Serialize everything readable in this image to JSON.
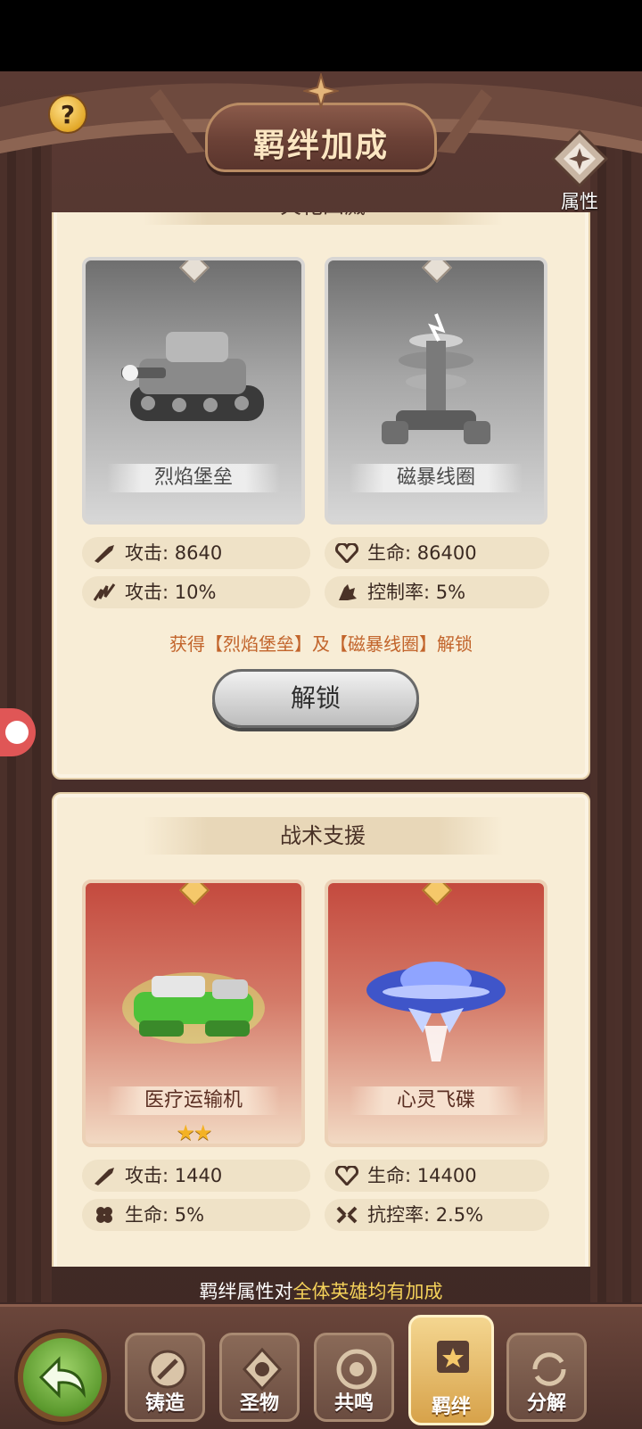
{
  "header": {
    "title": "羁绊加成",
    "help_label": "?",
    "attr_label": "属性"
  },
  "colors": {
    "panel_bg": "#f8edd6",
    "accent_orange": "#c2642b",
    "gold": "#f5d25a",
    "wood": "#4a302b"
  },
  "panels": [
    {
      "title": "火花四溅",
      "cards": [
        {
          "name": "烈焰堡垒",
          "state": "locked",
          "stars": ""
        },
        {
          "name": "磁暴线圈",
          "state": "locked",
          "stars": ""
        }
      ],
      "stats": [
        {
          "label": "攻击: 8640",
          "icon": "sword-icon"
        },
        {
          "label": "生命: 86400",
          "icon": "heart-icon"
        },
        {
          "label": "攻击: 10%",
          "icon": "claw-icon"
        },
        {
          "label": "控制率: 5%",
          "icon": "hand-icon"
        }
      ],
      "unlock_hint": "获得【烈焰堡垒】及【磁暴线圈】解锁",
      "unlock_button": "解锁"
    },
    {
      "title": "战术支援",
      "cards": [
        {
          "name": "医疗运输机",
          "state": "owned",
          "stars": "★★"
        },
        {
          "name": "心灵飞碟",
          "state": "owned",
          "stars": ""
        }
      ],
      "stats": [
        {
          "label": "攻击: 1440",
          "icon": "sword-icon"
        },
        {
          "label": "生命: 14400",
          "icon": "heart-icon"
        },
        {
          "label": "生命: 5%",
          "icon": "flower-icon"
        },
        {
          "label": "抗控率: 2.5%",
          "icon": "shield-break-icon"
        }
      ]
    }
  ],
  "footer": {
    "note_prefix": "羁绊属性对",
    "note_highlight": "全体英雄均有加成"
  },
  "nav": {
    "back_label": "back",
    "items": [
      {
        "label": "铸造",
        "icon": "forge-icon",
        "active": false
      },
      {
        "label": "圣物",
        "icon": "relic-icon",
        "active": false
      },
      {
        "label": "共鸣",
        "icon": "resonance-icon",
        "active": false
      },
      {
        "label": "羁绊",
        "icon": "bond-icon",
        "active": true
      },
      {
        "label": "分解",
        "icon": "decompose-icon",
        "active": false
      }
    ]
  }
}
